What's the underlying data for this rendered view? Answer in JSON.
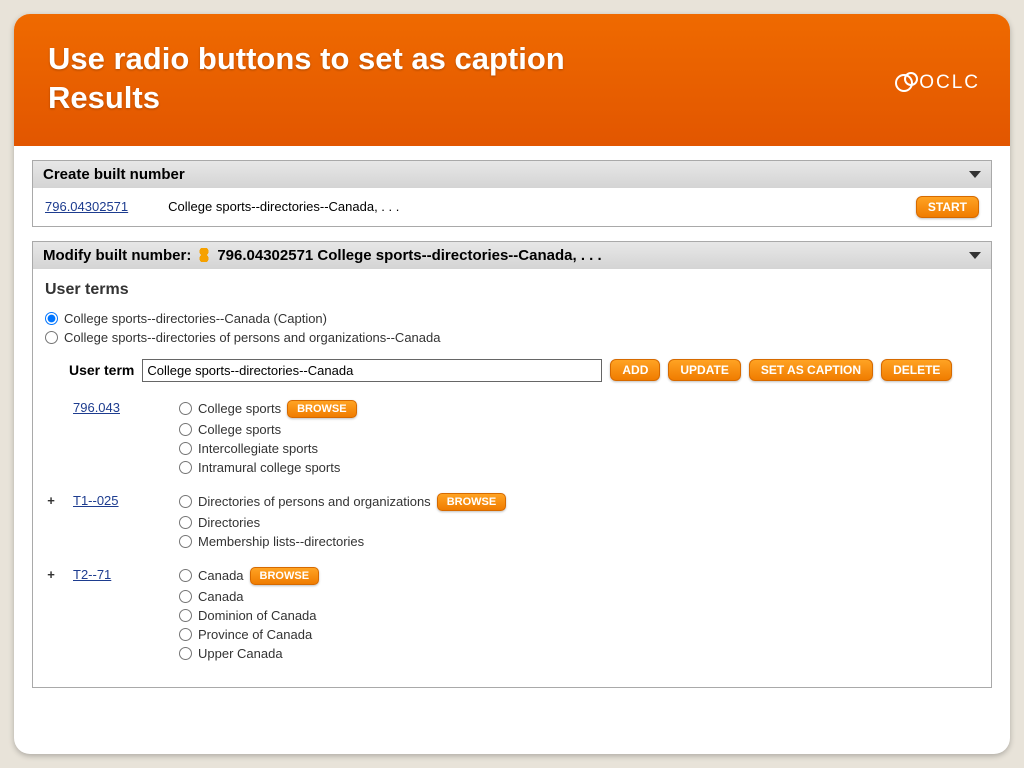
{
  "brand": "OCLC",
  "title_line1": "Use radio buttons to set as caption",
  "title_line2": "Results",
  "create_panel": {
    "header": "Create built number",
    "number_link": "796.04302571",
    "description": "College sports--directories--Canada, . . .",
    "start_label": "START"
  },
  "modify_panel": {
    "header_prefix": "Modify built number:",
    "header_value": "796.04302571 College sports--directories--Canada, . . .",
    "user_terms_title": "User terms",
    "radio_caption": "College sports--directories--Canada  (Caption)",
    "radio_alt": "College sports--directories of persons and organizations--Canada",
    "user_term_label": "User term",
    "user_term_value": "College sports--directories--Canada",
    "buttons": {
      "add": "ADD",
      "update": "UPDATE",
      "set_caption": "SET AS CAPTION",
      "delete": "DELETE",
      "browse": "BROWSE"
    }
  },
  "term_blocks": [
    {
      "plus": "",
      "code": "796.043",
      "primary": "College sports",
      "options": [
        "College sports",
        "Intercollegiate sports",
        "Intramural college sports"
      ]
    },
    {
      "plus": "+",
      "code": "T1--025",
      "primary": "Directories of persons and organizations",
      "options": [
        "Directories",
        "Membership lists--directories"
      ]
    },
    {
      "plus": "+",
      "code": "T2--71",
      "primary": "Canada",
      "options": [
        "Canada",
        "Dominion of Canada",
        "Province of Canada",
        "Upper Canada"
      ]
    }
  ]
}
